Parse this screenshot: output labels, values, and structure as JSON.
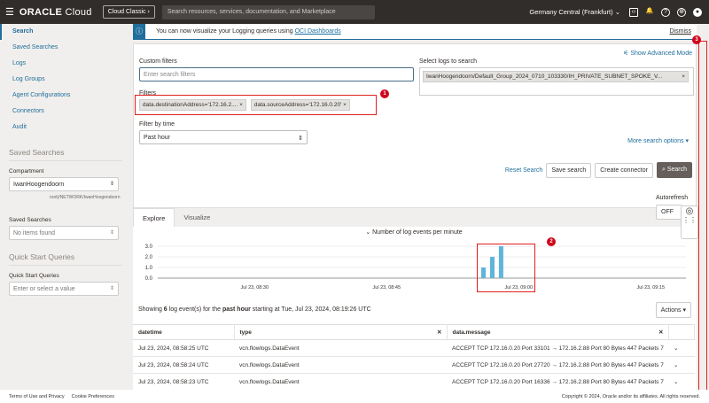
{
  "header": {
    "brand": "ORACLE",
    "brand_suffix": "Cloud",
    "classic_label": "Cloud Classic",
    "search_placeholder": "Search resources, services, documentation, and Marketplace",
    "region": "Germany Central (Frankfurt)"
  },
  "sidebar": {
    "items": [
      {
        "label": "Search",
        "active": true
      },
      {
        "label": "Saved Searches"
      },
      {
        "label": "Logs"
      },
      {
        "label": "Log Groups"
      },
      {
        "label": "Agent Configurations"
      },
      {
        "label": "Connectors"
      },
      {
        "label": "Audit"
      }
    ],
    "saved_heading": "Saved Searches",
    "compartment_label": "Compartment",
    "compartment_value": "IwanHoogendoorn",
    "compartment_path": "root)/NETWORK/IwanHoogendoorn",
    "saved_label": "Saved Searches",
    "saved_value": "No items found",
    "qs_heading": "Quick Start Queries",
    "qs_label": "Quick Start Queries",
    "qs_placeholder": "Enter or select a value"
  },
  "banner": {
    "text": "You can now visualize your Logging queries using ",
    "link": "OCI Dashboards",
    "dismiss": "Dismiss"
  },
  "search": {
    "advanced": "Show Advanced Mode",
    "custom_label": "Custom filters",
    "custom_placeholder": "Enter search filters",
    "logs_label": "Select logs to search",
    "log_chip": "IwanHoogendoorn/Default_Group_2024_0710_103330/IH_PRIVATE_SUBNET_SPOKE_V...",
    "filters_label": "Filters",
    "filters": [
      "data.destinationAddress='172.16.2....",
      "data.sourceAddress='172.16.0.20'"
    ],
    "time_label": "Filter by time",
    "time_value": "Past hour",
    "more_options": "More search options",
    "reset": "Reset Search",
    "save": "Save search",
    "create_connector": "Create connector",
    "search_btn": "Search"
  },
  "annotations": [
    "1",
    "2",
    "3"
  ],
  "tabs": [
    "Explore",
    "Visualize"
  ],
  "autorefresh": {
    "label": "Autorefresh",
    "value": "OFF"
  },
  "chart_data": {
    "type": "bar",
    "title": "Number of log events per minute",
    "x": [
      "08:56",
      "08:57",
      "08:58"
    ],
    "values": [
      1,
      2,
      3
    ],
    "yticks": [
      "3.0",
      "2.0",
      "1.0",
      "0.0"
    ],
    "ylim": [
      0,
      3
    ],
    "xticks": [
      "Jul 23, 08:30",
      "Jul 23, 08:45",
      "Jul 23, 09:00",
      "Jul 23, 09:15"
    ],
    "xrange": [
      "08:19",
      "09:19"
    ],
    "color": "#5fb4d9",
    "grid": true
  },
  "summary": {
    "prefix": "Showing ",
    "count": "6",
    "mid": " log event(s) for the ",
    "period": "past hour",
    "suffix": " starting at Tue, Jul 23, 2024, 08:19:26 UTC"
  },
  "actions": "Actions",
  "table": {
    "columns": [
      "datetime",
      "type",
      "data.message"
    ],
    "rows": [
      [
        "Jul 23, 2024, 08:58:25 UTC",
        "vcn.flowlogs.DataEvent",
        "ACCEPT TCP 172.16.0.20 Port 33101 → 172.16.2.88 Port 80 Bytes 447 Packets 7"
      ],
      [
        "Jul 23, 2024, 08:58:24 UTC",
        "vcn.flowlogs.DataEvent",
        "ACCEPT TCP 172.16.0.20 Port 27720 → 172.16.2.88 Port 80 Bytes 447 Packets 7"
      ],
      [
        "Jul 23, 2024, 08:58:23 UTC",
        "vcn.flowlogs.DataEvent",
        "ACCEPT TCP 172.16.0.20 Port 16336 → 172.16.2.88 Port 80 Bytes 447 Packets 7"
      ]
    ]
  },
  "footer": {
    "terms": "Terms of Use and Privacy",
    "cookies": "Cookie Preferences",
    "copyright": "Copyright © 2024, Oracle and/or its affiliates. All rights reserved."
  }
}
